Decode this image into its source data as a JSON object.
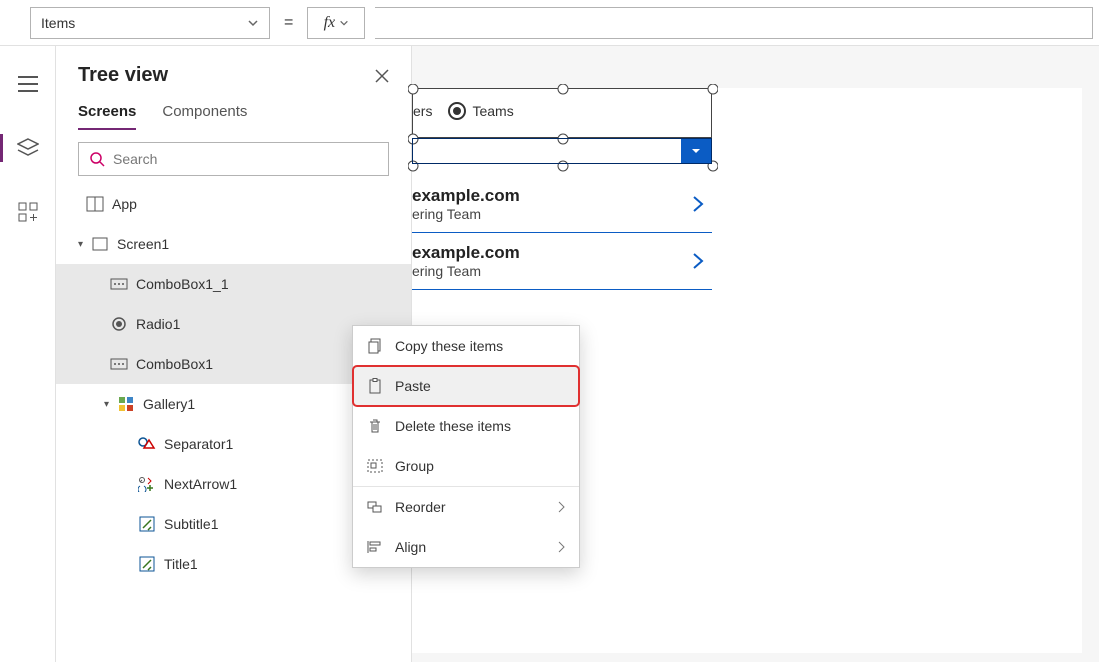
{
  "formula": {
    "property": "Items"
  },
  "rail": {
    "items": [
      "hamburger",
      "tree-view",
      "insert"
    ]
  },
  "tree": {
    "title": "Tree view",
    "tabs": {
      "screens": "Screens",
      "components": "Components"
    },
    "searchPlaceholder": "Search",
    "nodes": {
      "app": "App",
      "screen1": "Screen1",
      "combobox1_1": "ComboBox1_1",
      "radio1": "Radio1",
      "combobox1": "ComboBox1",
      "gallery1": "Gallery1",
      "separator1": "Separator1",
      "nextarrow1": "NextArrow1",
      "subtitle1": "Subtitle1",
      "title1": "Title1"
    }
  },
  "canvas": {
    "radio": {
      "opt1": "ers",
      "opt2": "Teams"
    },
    "gallery": [
      {
        "title": "example.com",
        "subtitle": "ering Team"
      },
      {
        "title": "example.com",
        "subtitle": "ering Team"
      }
    ]
  },
  "ctx": {
    "copy": "Copy these items",
    "paste": "Paste",
    "delete": "Delete these items",
    "group": "Group",
    "reorder": "Reorder",
    "align": "Align"
  }
}
